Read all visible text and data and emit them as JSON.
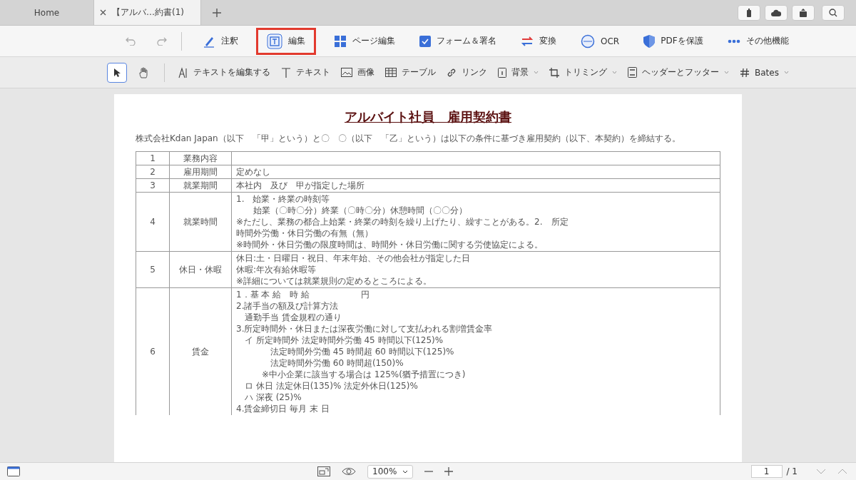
{
  "tabs": [
    {
      "label": "Home",
      "selected": false
    },
    {
      "label": "【アルバ…約書(1)",
      "selected": true
    }
  ],
  "toolbar": {
    "items": [
      {
        "label": "注釈",
        "selected": false
      },
      {
        "label": "編集",
        "selected": true
      },
      {
        "label": "ページ編集",
        "selected": false
      },
      {
        "label": "フォーム＆署名",
        "selected": false
      },
      {
        "label": "変換",
        "selected": false
      },
      {
        "label": "OCR",
        "selected": false
      },
      {
        "label": "PDFを保護",
        "selected": false
      },
      {
        "label": "その他機能",
        "selected": false
      }
    ]
  },
  "subtoolbar": {
    "modes": [
      {
        "kind": "pointer",
        "selected": true
      },
      {
        "kind": "hand",
        "selected": false
      }
    ],
    "items": [
      {
        "label": "テキストを編集する",
        "dropdown": false
      },
      {
        "label": "テキスト",
        "dropdown": false
      },
      {
        "label": "画像",
        "dropdown": false
      },
      {
        "label": "テーブル",
        "dropdown": false
      },
      {
        "label": "リンク",
        "dropdown": false
      },
      {
        "label": "背景",
        "dropdown": true
      },
      {
        "label": "トリミング",
        "dropdown": true
      },
      {
        "label": "ヘッダーとフッター",
        "dropdown": true
      },
      {
        "label": "Bates",
        "dropdown": true
      }
    ]
  },
  "document": {
    "title": "アルバイト社員　雇用契約書",
    "intro": "株式会社Kdan Japan（以下　「甲」という）と〇　〇（以下　「乙」という）は以下の条件に基づき雇用契約（以下、本契約）を締結する。",
    "rows": [
      {
        "no": "1",
        "item": "業務内容",
        "lines": []
      },
      {
        "no": "2",
        "item": "雇用期間",
        "lines": [
          "定めなし"
        ]
      },
      {
        "no": "3",
        "item": "就業期間",
        "lines": [
          "本社内　及び　甲が指定した場所"
        ]
      },
      {
        "no": "4",
        "item": "就業時間",
        "lines": [
          "1.　始業・終業の時刻等",
          "　　始業（〇時〇分）終業（〇時〇分）休憩時間（〇〇分）",
          "※ただし、業務の都合上始業・終業の時刻を繰り上げたり、繰すことがある。2.　所定",
          "時間外労働・休日労働の有無（無）",
          "※時間外・休日労働の限度時間は、時間外・休日労働に関する労使協定による。"
        ]
      },
      {
        "no": "5",
        "item": "休日・休暇",
        "lines": [
          "休日:土・日曜日・祝日、年末年始、その他会社が指定した日",
          "休暇:年次有給休暇等",
          "※詳細については就業規則の定めるところによる。"
        ]
      },
      {
        "no": "6",
        "item": "賃金",
        "lines": [
          "1．基 本 給　時 給　　　　　　円",
          "2.諸手当の額及び計算方法",
          "　通勤手当 賃金規程の通り",
          "3.所定時間外・休日または深夜労働に対して支払われる割増賃金率",
          "　イ 所定時間外 法定時間外労働 45 時間以下(125)%",
          "　　　　法定時間外労働 45 時間超 60 時間以下(125)%",
          "　　　　法定時間外労働 60 時間超(150)%",
          "　　　※中小企業に該当する場合は 125%(猶予措置につき)",
          "　ロ 休日 法定休日(135)% 法定外休日(125)%",
          "　ハ 深夜 (25)%",
          "4.賃金締切日 毎月 末 日"
        ]
      }
    ]
  },
  "statusbar": {
    "zoom": "100%",
    "page": "1",
    "total": "/ 1"
  }
}
